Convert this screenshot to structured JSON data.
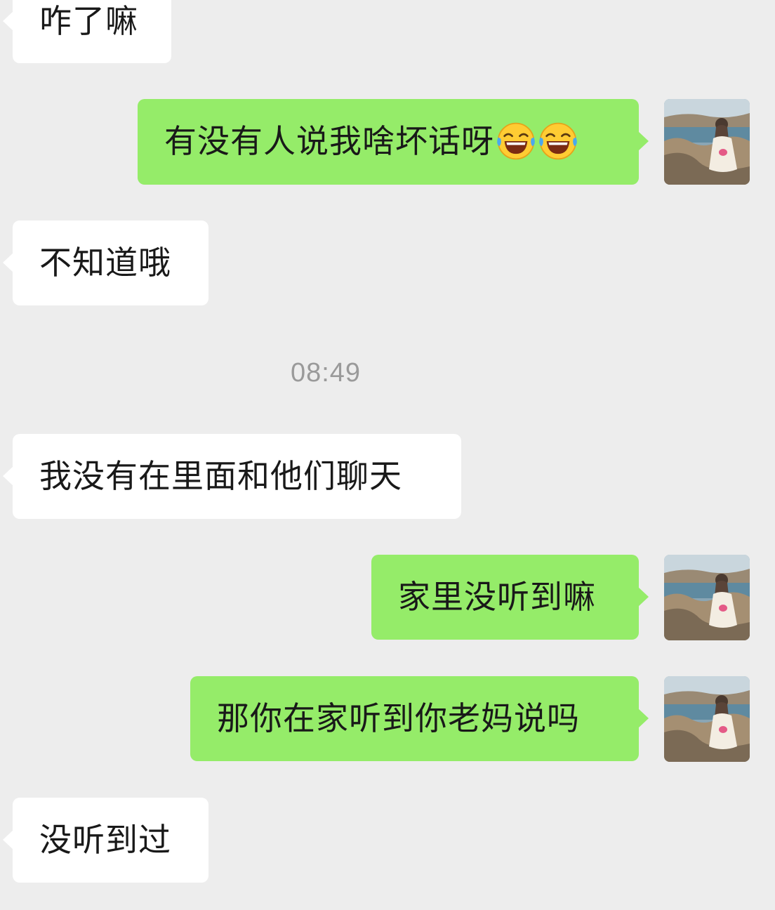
{
  "messages": [
    {
      "side": "incoming",
      "text": "咋了嘛"
    },
    {
      "side": "outgoing",
      "text": "有没有人说我啥坏话呀",
      "emojis": [
        "laughing-tears-emoji",
        "laughing-tears-emoji"
      ]
    },
    {
      "side": "incoming",
      "text": "不知道哦"
    },
    {
      "side": "incoming",
      "text": "我没有在里面和他们聊天"
    },
    {
      "side": "outgoing",
      "text": "家里没听到嘛"
    },
    {
      "side": "outgoing",
      "text": "那你在家听到你老妈说吗"
    },
    {
      "side": "incoming",
      "text": "没听到过"
    }
  ],
  "timestamp": "08:49",
  "colors": {
    "background": "#ededed",
    "incoming_bubble": "#ffffff",
    "outgoing_bubble": "#95ec69",
    "timestamp_text": "#9a9a9a"
  },
  "avatar": {
    "icon": "user-avatar-photo"
  }
}
